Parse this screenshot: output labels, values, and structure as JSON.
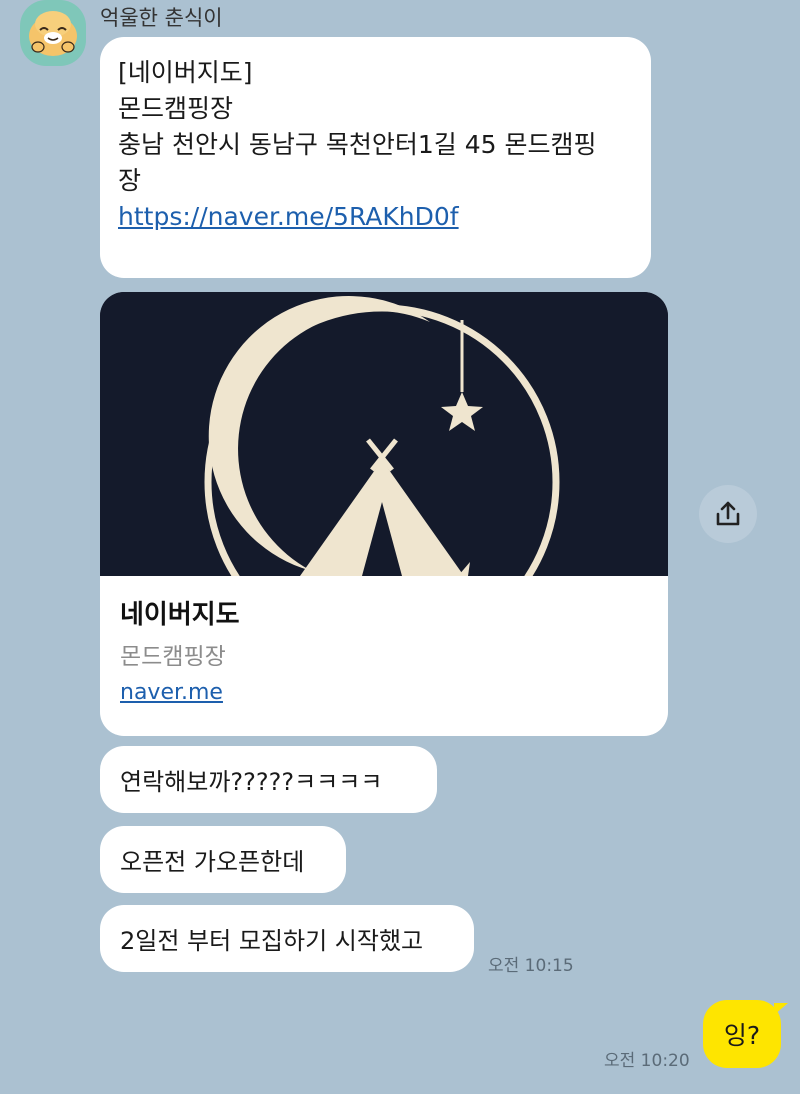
{
  "sender": {
    "name": "억울한 춘식이",
    "avatar_icon": "choonsik-avatar"
  },
  "message_1": {
    "lines": [
      "[네이버지도]",
      "몬드캠핑장",
      "충남 천안시 동남구 목천안터1길 45 몬드캠핑",
      "장"
    ],
    "link": "https://naver.me/5RAKhD0f"
  },
  "link_card": {
    "title": "네이버지도",
    "subtitle": "몬드캠핑장",
    "domain": "naver.me",
    "image_icon": "moon-tent-logo"
  },
  "share_button": {
    "icon": "share-icon"
  },
  "messages": [
    {
      "text": "연락해보까?????ㅋㅋㅋㅋ"
    },
    {
      "text": "오픈전 가오픈한데"
    },
    {
      "text": "2일전 부터 모집하기 시작했고"
    }
  ],
  "received_time": "오전 10:15",
  "my_message": {
    "text": "잉?",
    "time": "오전 10:20"
  },
  "colors": {
    "background": "#abc1d1",
    "bubble_other": "#ffffff",
    "bubble_mine": "#fee500",
    "link": "#1d5fad"
  }
}
